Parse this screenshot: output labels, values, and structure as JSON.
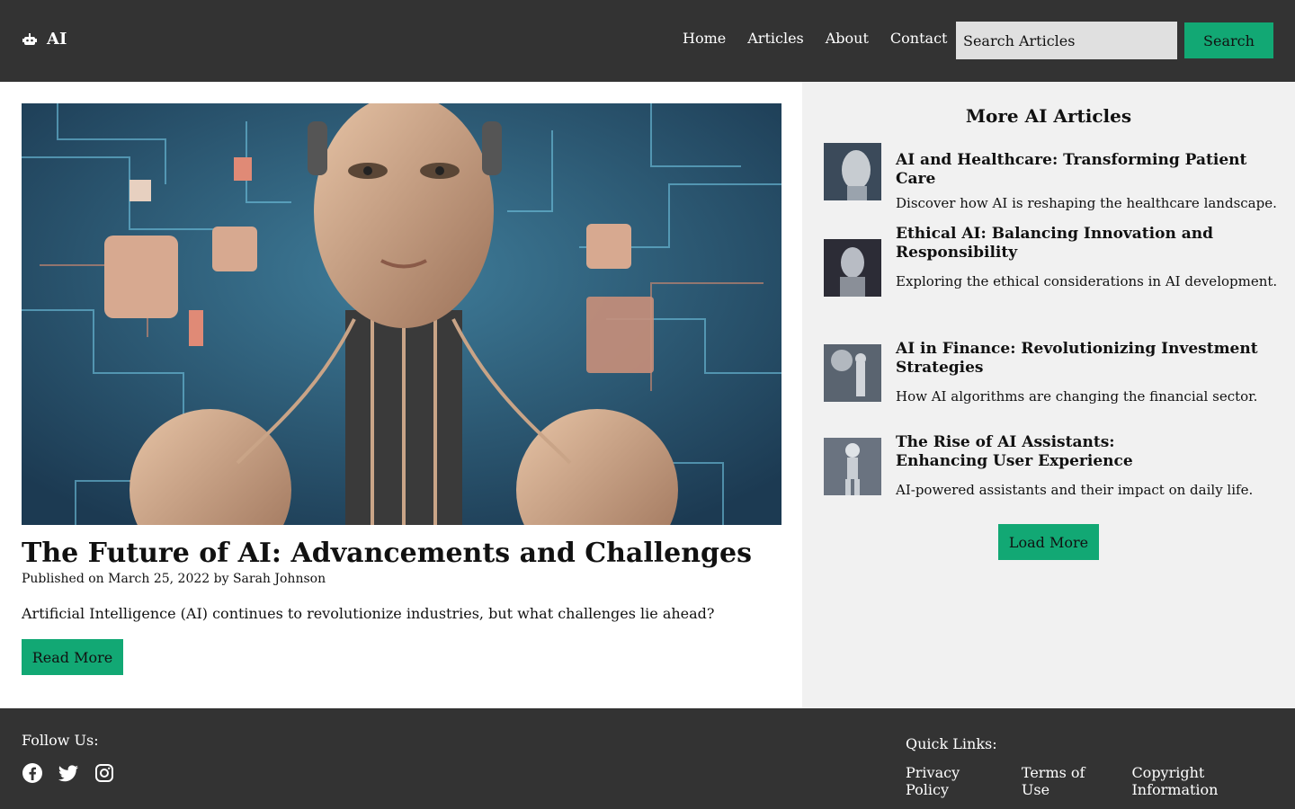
{
  "header": {
    "logo_text": "AI",
    "logo_icon": "robot-icon",
    "nav": [
      "Home",
      "Articles",
      "About",
      "Contact"
    ],
    "search_placeholder": "Search Articles",
    "search_button": "Search"
  },
  "featured": {
    "image_alt": "robot-face-circuit-illustration",
    "title": "The Future of AI: Advancements and Challenges",
    "meta": "Published on March 25, 2022 by Sarah Johnson",
    "summary": "Artificial Intelligence (AI) continues to revolutionize industries, but what challenges lie ahead?",
    "read_more": "Read More"
  },
  "sidebar": {
    "title": "More AI Articles",
    "items": [
      {
        "title": "AI and Healthcare: Transforming Patient Care",
        "desc": "Discover how AI is reshaping the healthcare landscape."
      },
      {
        "title": "Ethical AI: Balancing Innovation and Responsibility",
        "desc": "Exploring the ethical considerations in AI development."
      },
      {
        "title": "AI in Finance: Revolutionizing Investment Strategies",
        "desc": "How AI algorithms are changing the financial sector."
      },
      {
        "title": "The Rise of AI Assistants: Enhancing User Experience",
        "desc": "AI-powered assistants and their impact on daily life."
      }
    ],
    "load_more": "Load More"
  },
  "footer": {
    "follow_label": "Follow Us:",
    "socials": [
      "facebook-icon",
      "twitter-icon",
      "instagram-icon"
    ],
    "quick_label": "Quick Links:",
    "quick_links": [
      "Privacy Policy",
      "Terms of Use",
      "Copyright Information"
    ]
  },
  "colors": {
    "header_bg": "#333333",
    "accent": "#12a874",
    "sidebar_bg": "#f1f1f1"
  }
}
